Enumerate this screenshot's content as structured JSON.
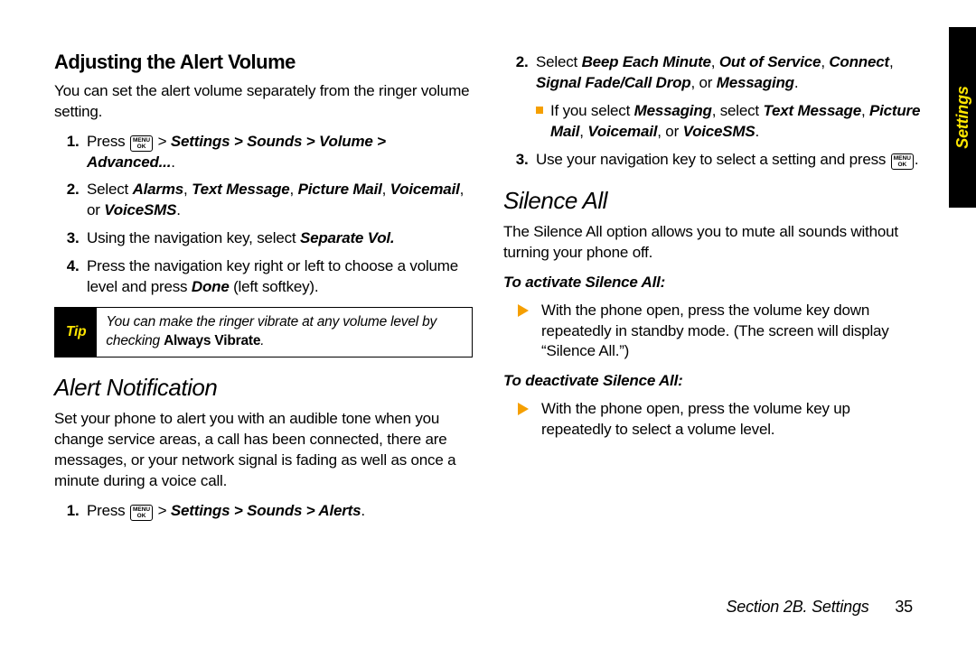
{
  "sideTab": "Settings",
  "footer": {
    "section": "Section 2B. Settings",
    "page": "35"
  },
  "menuKey": {
    "line1": "MENU",
    "line2": "OK"
  },
  "left": {
    "h1": "Adjusting the Alert Volume",
    "intro": "You can set the alert volume separately from the ringer volume setting.",
    "step1_pre": "Press ",
    "step1_post": " > ",
    "step1_path": "Settings > Sounds > Volume > Advanced...",
    "step2_a": "Select ",
    "step2_opts": "Alarms",
    "step2_sep1": ", ",
    "step2_o2": "Text Message",
    "step2_sep2": ", ",
    "step2_o3": "Picture Mail",
    "step2_sep3": ", ",
    "step2_o4": "Voicemail",
    "step2_sep4": ", or ",
    "step2_o5": "VoiceSMS",
    "step2_end": ".",
    "step3_a": "Using the navigation key, select ",
    "step3_b": "Separate Vol.",
    "step4_a": "Press the navigation key right or left to choose a volume level and press ",
    "step4_b": "Done",
    "step4_c": " (left softkey).",
    "tipLabel": "Tip",
    "tip_a": "You can make the ringer vibrate at any volume level by checking ",
    "tip_b": "Always Vibrate",
    "tip_c": ".",
    "h2": "Alert Notification",
    "alertIntro": "Set your phone to alert you with an audible tone when you change service areas, a call has been connected, there are messages, or your network signal is fading as well as once a minute during a voice call.",
    "alertStep1_pre": "Press ",
    "alertStep1_path": "Settings > Sounds > Alerts",
    "alertStep1_end": "."
  },
  "right": {
    "step2_a": "Select ",
    "step2_o1": "Beep Each Minute",
    "sep1": ", ",
    "step2_o2": "Out of Service",
    "sep2": ", ",
    "step2_o3": "Connect",
    "sep3": ", ",
    "step2_o4": "Signal Fade/Call Drop",
    "sep4": ", or ",
    "step2_o5": "Messaging",
    "step2_end": ".",
    "sub_a": "If you select ",
    "sub_b": "Messaging",
    "sub_c": ", select ",
    "sub_d": "Text Message",
    "sub_e": ", ",
    "sub_f": "Picture Mail",
    "sub_g": ", ",
    "sub_h": "Voicemail",
    "sub_i": ", or ",
    "sub_j": "VoiceSMS",
    "sub_k": ".",
    "step3_a": "Use your navigation key to select a setting and press ",
    "step3_end": ".",
    "hSilence": "Silence All",
    "silenceIntro": "The Silence All option allows you to mute all sounds without turning your phone off.",
    "activateHead": "To activate Silence All:",
    "activateBody": "With the phone open, press the volume key down repeatedly in standby mode. (The screen will display “Silence All.”)",
    "deactivateHead": "To deactivate Silence All:",
    "deactivateBody": "With the phone open, press the volume key up repeatedly to select a volume level."
  }
}
